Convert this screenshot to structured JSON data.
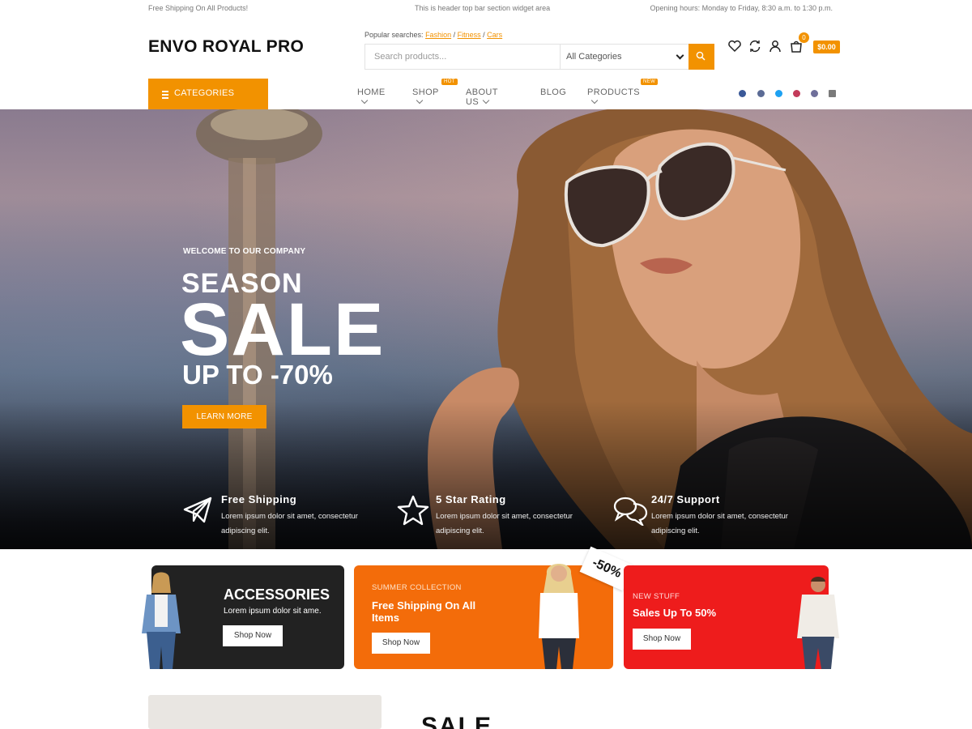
{
  "topbar": {
    "left": "Free Shipping On All Products!",
    "middle": "This is header top bar section widget area",
    "right": "Opening hours: Monday to Friday, 8:30 a.m. to 1:30 p.m."
  },
  "header": {
    "logo": "ENVO ROYAL PRO",
    "popular_label": "Popular searches:",
    "popular_links": [
      "Fashion",
      "Fitness",
      "Cars"
    ],
    "search_placeholder": "Search products...",
    "category_select": "All Categories",
    "cart_count": "0",
    "cart_total": "$0.00",
    "icons": [
      "heart-icon",
      "compare-icon",
      "user-icon",
      "cart-icon"
    ]
  },
  "nav": {
    "categories_button": "CATEGORIES",
    "items": [
      {
        "label": "HOME",
        "badge": ""
      },
      {
        "label": "SHOP",
        "badge": "HOT"
      },
      {
        "label": "ABOUT US",
        "badge": ""
      },
      {
        "label": "BLOG",
        "badge": ""
      },
      {
        "label": "PRODUCTS",
        "badge": "NEW"
      }
    ],
    "socials": [
      "facebook-icon",
      "pinterest-icon",
      "twitter-icon",
      "youtube-icon",
      "instagram-icon",
      "calendar-icon"
    ]
  },
  "hero": {
    "welcome": "WELCOME TO OUR COMPANY",
    "line1": "SEASON",
    "line2": "SALE",
    "line3": "UP TO -70%",
    "button": "LEARN MORE",
    "features": [
      {
        "icon": "paper-plane-icon",
        "title": "Free Shipping",
        "text": "Lorem ipsum dolor sit amet, consectetur adipiscing elit."
      },
      {
        "icon": "star-icon",
        "title": "5 Star Rating",
        "text": "Lorem ipsum dolor sit amet, consectetur adipiscing elit."
      },
      {
        "icon": "chat-icon",
        "title": "24/7 Support",
        "text": "Lorem ipsum dolor sit amet, consectetur adipiscing elit."
      }
    ]
  },
  "promos": [
    {
      "title": "ACCESSORIES",
      "text": "Lorem ipsum dolor sit ame.",
      "button": "Shop Now"
    },
    {
      "small": "SUMMER COLLECTION",
      "title": "Free Shipping On All Items",
      "button": "Shop Now",
      "tag": "-50%"
    },
    {
      "small": "NEW STUFF",
      "title": "Sales Up To 50%",
      "button": "Shop Now"
    }
  ],
  "section": {
    "title": "SALE"
  },
  "colors": {
    "accent": "#f29200",
    "promo_dark": "#222222",
    "promo_orange": "#f36c0a",
    "promo_red": "#ee1c1c"
  }
}
